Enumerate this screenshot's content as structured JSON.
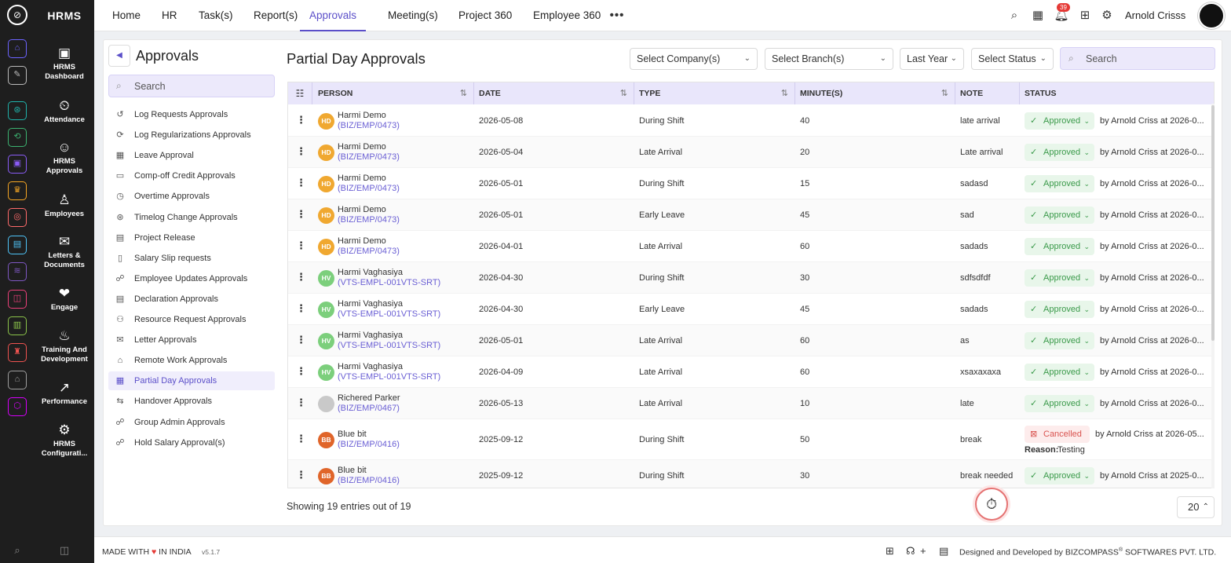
{
  "brand": "HRMS",
  "nav": {
    "items": [
      "Home",
      "HR",
      "Task(s)",
      "Report(s)",
      "Approvals",
      "Meeting(s)",
      "Project 360",
      "Employee 360"
    ],
    "active": "Approvals",
    "more_icon": "more-icon"
  },
  "header": {
    "notification_count": "39",
    "user_name": "Arnold Crisss"
  },
  "modules": [
    {
      "label": "HRMS Dashboard",
      "icon": "dashboard-icon"
    },
    {
      "label": "Attendance",
      "icon": "attendance-icon"
    },
    {
      "label": "HRMS Approvals",
      "icon": "approvals-icon"
    },
    {
      "label": "Employees",
      "icon": "employees-icon"
    },
    {
      "label": "Letters & Documents",
      "icon": "letters-icon"
    },
    {
      "label": "Engage",
      "icon": "engage-icon"
    },
    {
      "label": "Training And Development",
      "icon": "training-icon"
    },
    {
      "label": "Performance",
      "icon": "performance-icon"
    },
    {
      "label": "HRMS Configurati...",
      "icon": "config-icon"
    }
  ],
  "rail_colors": [
    "#6c63ff",
    "#bbbbbb",
    "#20b2aa",
    "#3cb371",
    "#8a5cf6",
    "#f5a623",
    "#ff6b6b",
    "#4fc3f7",
    "#7e57c2",
    "#ec407a",
    "#8bc34a",
    "#ef5350",
    "#9e9e9e",
    "#d500f9"
  ],
  "panel": {
    "title": "Approvals",
    "search_placeholder": "Search",
    "items": [
      {
        "label": "Log Requests Approvals",
        "icon": "history-icon"
      },
      {
        "label": "Log Regularizations Approvals",
        "icon": "refresh-icon"
      },
      {
        "label": "Leave Approval",
        "icon": "calendar-icon"
      },
      {
        "label": "Comp-off Credit Approvals",
        "icon": "card-icon"
      },
      {
        "label": "Overtime Approvals",
        "icon": "clock-icon"
      },
      {
        "label": "Timelog Change Approvals",
        "icon": "timelog-icon"
      },
      {
        "label": "Project Release",
        "icon": "project-icon"
      },
      {
        "label": "Salary Slip requests",
        "icon": "document-icon"
      },
      {
        "label": "Employee Updates Approvals",
        "icon": "user-edit-icon"
      },
      {
        "label": "Declaration Approvals",
        "icon": "declaration-icon"
      },
      {
        "label": "Resource Request Approvals",
        "icon": "resource-icon"
      },
      {
        "label": "Letter Approvals",
        "icon": "mail-icon"
      },
      {
        "label": "Remote Work Approvals",
        "icon": "home-icon"
      },
      {
        "label": "Partial Day Approvals",
        "icon": "partial-day-icon"
      },
      {
        "label": "Handover Approvals",
        "icon": "handover-icon"
      },
      {
        "label": "Group Admin Approvals",
        "icon": "group-admin-icon"
      },
      {
        "label": "Hold Salary Approval(s)",
        "icon": "hold-salary-icon"
      }
    ],
    "active": "Partial Day Approvals"
  },
  "main": {
    "title": "Partial Day Approvals",
    "filters": {
      "company": "Select Company(s)",
      "branch": "Select Branch(s)",
      "period": "Last Year",
      "status": "Select Status"
    },
    "search_placeholder": "Search"
  },
  "table": {
    "columns": [
      "PERSON",
      "DATE",
      "TYPE",
      "MINUTE(S)",
      "NOTE",
      "STATUS"
    ],
    "rows": [
      {
        "initials": "HD",
        "avatar_color": "#f0a830",
        "name": "Harmi Demo",
        "code": "(BIZ/EMP/0473)",
        "date": "2026-05-08",
        "type": "During Shift",
        "minutes": "40",
        "note": "late arrival",
        "status": "Approved",
        "by": "by Arnold Criss at 2026-0..."
      },
      {
        "initials": "HD",
        "avatar_color": "#f0a830",
        "name": "Harmi Demo",
        "code": "(BIZ/EMP/0473)",
        "date": "2026-05-04",
        "type": "Late Arrival",
        "minutes": "20",
        "note": "Late arrival",
        "status": "Approved",
        "by": "by Arnold Criss at 2026-0..."
      },
      {
        "initials": "HD",
        "avatar_color": "#f0a830",
        "name": "Harmi Demo",
        "code": "(BIZ/EMP/0473)",
        "date": "2026-05-01",
        "type": "During Shift",
        "minutes": "15",
        "note": "sadasd",
        "status": "Approved",
        "by": "by Arnold Criss at 2026-0..."
      },
      {
        "initials": "HD",
        "avatar_color": "#f0a830",
        "name": "Harmi Demo",
        "code": "(BIZ/EMP/0473)",
        "date": "2026-05-01",
        "type": "Early Leave",
        "minutes": "45",
        "note": "sad",
        "status": "Approved",
        "by": "by Arnold Criss at 2026-0..."
      },
      {
        "initials": "HD",
        "avatar_color": "#f0a830",
        "name": "Harmi Demo",
        "code": "(BIZ/EMP/0473)",
        "date": "2026-04-01",
        "type": "Late Arrival",
        "minutes": "60",
        "note": "sadads",
        "status": "Approved",
        "by": "by Arnold Criss at 2026-0..."
      },
      {
        "initials": "HV",
        "avatar_color": "#7ccf7c",
        "name": "Harmi Vaghasiya",
        "code": "(VTS-EMPL-001VTS-SRT)",
        "date": "2026-04-30",
        "type": "During Shift",
        "minutes": "30",
        "note": "sdfsdfdf",
        "status": "Approved",
        "by": "by Arnold Criss at 2026-0..."
      },
      {
        "initials": "HV",
        "avatar_color": "#7ccf7c",
        "name": "Harmi Vaghasiya",
        "code": "(VTS-EMPL-001VTS-SRT)",
        "date": "2026-04-30",
        "type": "Early Leave",
        "minutes": "45",
        "note": "sadads",
        "status": "Approved",
        "by": "by Arnold Criss at 2026-0..."
      },
      {
        "initials": "HV",
        "avatar_color": "#7ccf7c",
        "name": "Harmi Vaghasiya",
        "code": "(VTS-EMPL-001VTS-SRT)",
        "date": "2026-05-01",
        "type": "Late Arrival",
        "minutes": "60",
        "note": "as",
        "status": "Approved",
        "by": "by Arnold Criss at 2026-0..."
      },
      {
        "initials": "HV",
        "avatar_color": "#7ccf7c",
        "name": "Harmi Vaghasiya",
        "code": "(VTS-EMPL-001VTS-SRT)",
        "date": "2026-04-09",
        "type": "Late Arrival",
        "minutes": "60",
        "note": "xsaxaxaxa",
        "status": "Approved",
        "by": "by Arnold Criss at 2026-0..."
      },
      {
        "initials": "",
        "avatar_color": "#c9c9c9",
        "name": "Richered Parker",
        "code": "(BIZ/EMP/0467)",
        "date": "2026-05-13",
        "type": "Late Arrival",
        "minutes": "10",
        "note": "late",
        "status": "Approved",
        "by": "by Arnold Criss at 2026-0..."
      },
      {
        "initials": "BB",
        "avatar_color": "#e0652a",
        "name": "Blue bit",
        "code": "(BIZ/EMP/0416)",
        "date": "2025-09-12",
        "type": "During Shift",
        "minutes": "50",
        "note": "break",
        "status": "Cancelled",
        "by": "by Arnold Criss at 2026-05...",
        "reason_label": "Reason:",
        "reason": "Testing"
      },
      {
        "initials": "BB",
        "avatar_color": "#e0652a",
        "name": "Blue bit",
        "code": "(BIZ/EMP/0416)",
        "date": "2025-09-12",
        "type": "During Shift",
        "minutes": "30",
        "note": "break needed",
        "status": "Approved",
        "by": "by Arnold Criss at 2025-0..."
      }
    ]
  },
  "footer": {
    "showing": "Showing 19 entries out of 19",
    "page_size": "20"
  },
  "bottombar": {
    "made_with": "MADE WITH",
    "in_india": "IN INDIA",
    "version": "v5.1.7",
    "designed_by": "Designed and Developed by",
    "company": "BIZCOMPASS",
    "company_suffix": "SOFTWARES PVT. LTD.",
    "reg": "®"
  },
  "colors": {
    "accent": "#5b4fc9",
    "approved": "#3a9a4a",
    "cancelled": "#d9534f",
    "header_bg": "#e9e6fb"
  }
}
